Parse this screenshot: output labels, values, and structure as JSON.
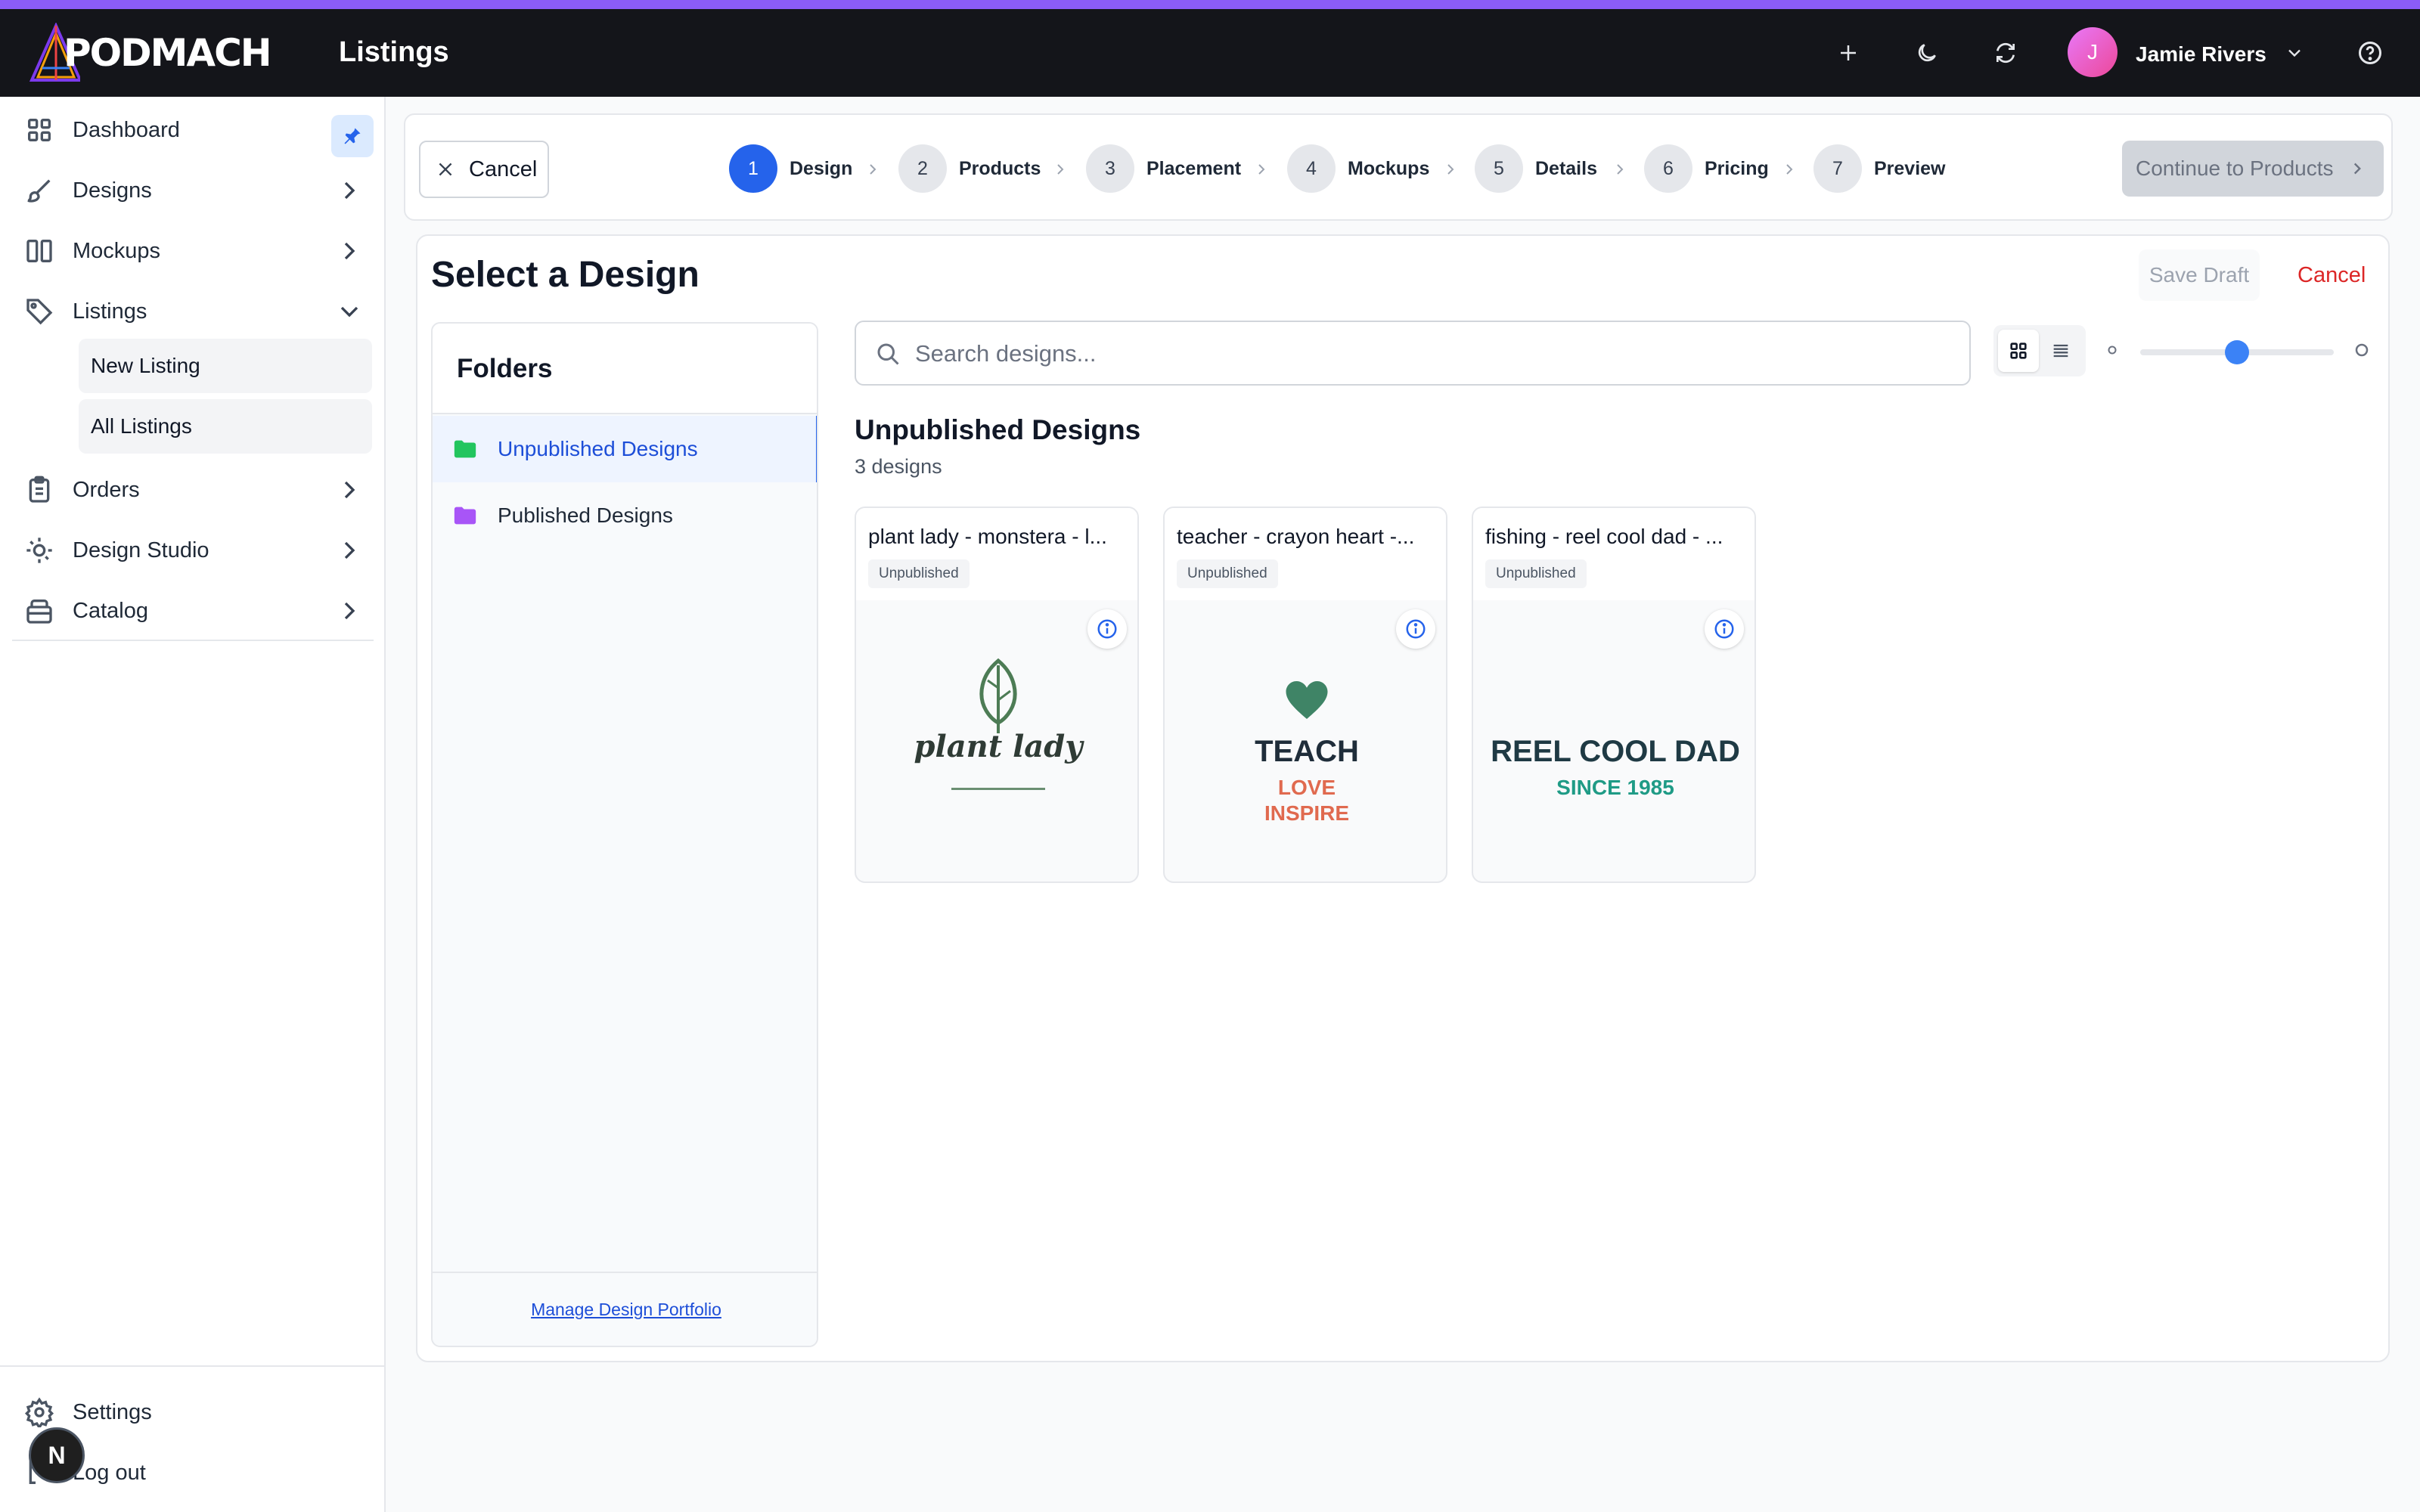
{
  "app": {
    "logo_text": "PODMACH",
    "page_title": "Listings",
    "user_name": "Jamie Rivers",
    "user_initial": "J"
  },
  "topbar_icons": [
    "plus-icon",
    "moon-icon",
    "refresh-icon",
    "chevron-down-icon",
    "help-icon"
  ],
  "sidebar": {
    "items": [
      {
        "label": "Dashboard",
        "icon": "dashboard-icon"
      },
      {
        "label": "Designs",
        "icon": "brush-icon"
      },
      {
        "label": "Mockups",
        "icon": "columns-icon"
      },
      {
        "label": "Listings",
        "icon": "tag-icon"
      },
      {
        "label": "Orders",
        "icon": "clipboard-icon"
      },
      {
        "label": "Design Studio",
        "icon": "lightbulb-icon"
      },
      {
        "label": "Catalog",
        "icon": "archive-icon"
      }
    ],
    "listings_sub": [
      "New Listing",
      "All Listings"
    ],
    "settings": "Settings",
    "logout": "Log out",
    "badge": "N"
  },
  "stepper": {
    "cancel_label": "Cancel",
    "steps": [
      {
        "num": "1",
        "label": "Design"
      },
      {
        "num": "2",
        "label": "Products"
      },
      {
        "num": "3",
        "label": "Placement"
      },
      {
        "num": "4",
        "label": "Mockups"
      },
      {
        "num": "5",
        "label": "Details"
      },
      {
        "num": "6",
        "label": "Pricing"
      },
      {
        "num": "7",
        "label": "Preview"
      }
    ],
    "continue_label": "Continue to Products"
  },
  "main": {
    "title": "Select a Design",
    "save_draft": "Save Draft",
    "cancel": "Cancel",
    "folders": {
      "heading": "Folders",
      "items": [
        "Unpublished Designs",
        "Published Designs"
      ],
      "manage_link": "Manage Design Portfolio"
    },
    "search": {
      "placeholder": "Search designs...",
      "value": ""
    },
    "view_mode": "grid",
    "thumbnail_size": 0.5,
    "folder_title": "Unpublished Designs",
    "folder_count": "3 designs",
    "designs": [
      {
        "name": "plant lady - monstera - l...",
        "status": "Unpublished",
        "art": {
          "line1": "plant lady"
        }
      },
      {
        "name": "teacher - crayon heart -...",
        "status": "Unpublished",
        "art": {
          "line1": "TEACH",
          "line2": "LOVE",
          "line3": "INSPIRE"
        }
      },
      {
        "name": "fishing - reel cool dad - ...",
        "status": "Unpublished",
        "art": {
          "line1": "REEL COOL DAD",
          "line2": "SINCE 1985"
        }
      }
    ]
  },
  "colors": {
    "accent": "#8b5cf6",
    "primary": "#2563eb",
    "danger": "#dc2626",
    "folder_green": "#22c55e",
    "folder_purple": "#a855f7"
  }
}
